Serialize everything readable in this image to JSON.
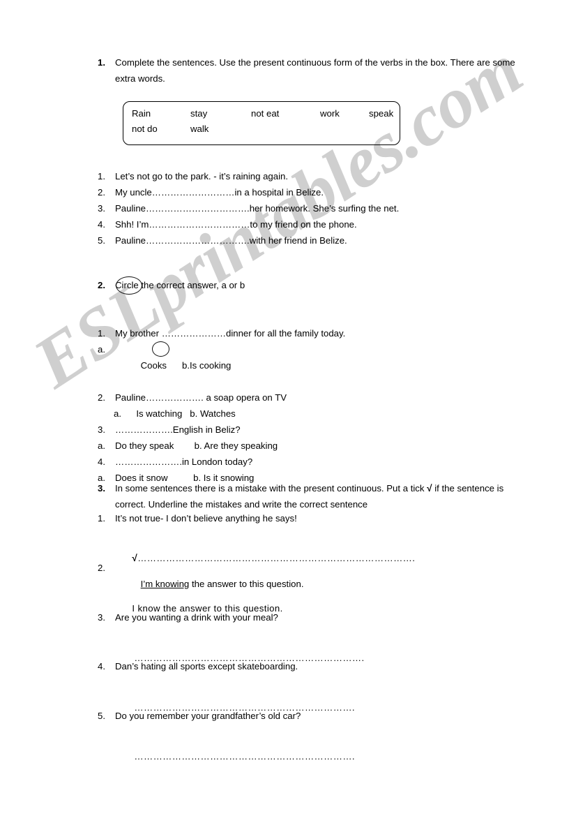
{
  "watermark": {
    "text": "ESLprintables.com",
    "color": "#cfcfcf"
  },
  "exercise1": {
    "number": "1.",
    "instruction": "Complete the sentences. Use the present continuous form of the verbs in the box. There are some extra words.",
    "word_bank": {
      "row1": [
        "Rain",
        "stay",
        "not eat",
        "work",
        "speak"
      ],
      "row2": [
        "not do",
        "walk"
      ]
    },
    "items": [
      {
        "mark": "1.",
        "text": "Let’s not go to the park. - it’s raining again."
      },
      {
        "mark": "2.",
        "text": "My uncle………………………in a hospital in Belize."
      },
      {
        "mark": "3.",
        "text": "Pauline…………………………….her homework. She’s surfing the net."
      },
      {
        "mark": "4.",
        "text": "Shh! I’m……………………………to my friend on the phone."
      },
      {
        "mark": "5.",
        "text": "Pauline…………………………….with her friend in Belize."
      }
    ]
  },
  "exercise2": {
    "number": "2.",
    "circled_word": "Circle",
    "instruction_rest": " the correct answer, a or b",
    "items": [
      {
        "mark": "1.",
        "text": "My brother …………………dinner for all the family today.",
        "sub": false
      },
      {
        "mark": "a.",
        "text_before": "Cooks      ",
        "option_b_mark": "b.",
        "option_b_text": "Is cooking",
        "circled": true,
        "sub": false
      },
      {
        "mark": "2.",
        "text": "Pauline………………. a soap opera on TV",
        "sub": false
      },
      {
        "mark": "a.",
        "text": "  Is watching   b. Watches",
        "sub": true
      },
      {
        "mark": "3.",
        "text": "……………….English in Beliz?",
        "sub": false
      },
      {
        "mark": "a.",
        "text": "Do they speak        b. Are they speaking",
        "sub": false
      },
      {
        "mark": "4.",
        "text": "………………….in London today?",
        "sub": false
      },
      {
        "mark": "a.",
        "text": "Does it snow          b. Is it snowing",
        "sub": false
      }
    ]
  },
  "exercise3": {
    "number": "3.",
    "instruction_part1": "In some sentences there is a mistake with the present continuous. Put a tick ",
    "instruction_tick": "√",
    "instruction_part2": " if the sentence is correct. Underline the mistakes and write the correct sentence",
    "items": [
      {
        "mark": "1.",
        "sentence_plain": "It’s not true- I don’t believe anything he says!",
        "answer_tick": "√",
        "answer_dots": "……………………………………………………………………………."
      },
      {
        "mark": "2.",
        "sentence_underlined": "I’m knowing",
        "sentence_rest": " the answer to this question.",
        "answer_written": "I know the answer to this question."
      },
      {
        "mark": "3.",
        "sentence_plain": "Are you wanting a drink with your meal?",
        "answer_dots": "………………………………………………………………."
      },
      {
        "mark": "4.",
        "sentence_plain": "Dan’s hating all sports except skateboarding.",
        "answer_dots": "……………………………………………………………."
      },
      {
        "mark": "5.",
        "sentence_plain": "Do you remember your grandfather’s old car?",
        "answer_dots": "……………………………………………………………."
      }
    ]
  }
}
